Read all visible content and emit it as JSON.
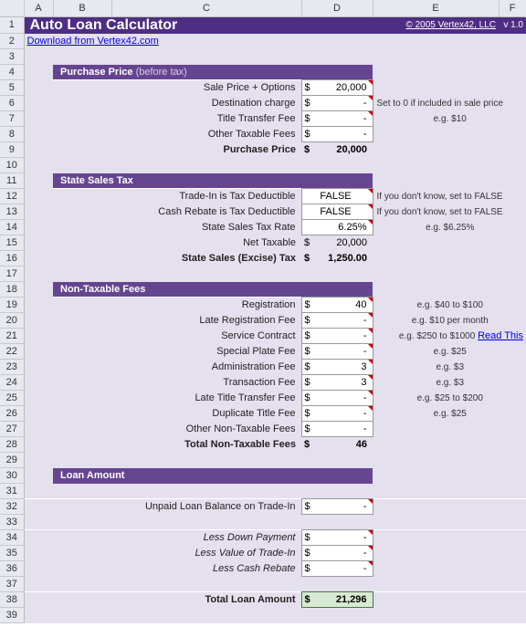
{
  "cols": [
    "",
    "A",
    "B",
    "C",
    "D",
    "E",
    "F"
  ],
  "title": "Auto Loan Calculator",
  "copyright": "© 2005 Vertex42, LLC",
  "version": "v 1.0",
  "download_link": "Download from Vertex42.com",
  "sections": {
    "purchase": {
      "title": "Purchase Price",
      "sub": "(before tax)"
    },
    "tax": {
      "title": "State Sales Tax"
    },
    "fees": {
      "title": "Non-Taxable Fees"
    },
    "loan": {
      "title": "Loan Amount"
    }
  },
  "rows": {
    "r5": {
      "label": "Sale Price + Options",
      "cur": "$",
      "val": "20,000",
      "note": ""
    },
    "r6": {
      "label": "Destination charge",
      "cur": "$",
      "val": "-",
      "note": "Set to 0 if included in sale price"
    },
    "r7": {
      "label": "Title Transfer Fee",
      "cur": "$",
      "val": "-",
      "note": "e.g. $10"
    },
    "r8": {
      "label": "Other Taxable Fees",
      "cur": "$",
      "val": "-",
      "note": ""
    },
    "r9": {
      "label": "Purchase Price",
      "cur": "$",
      "val": "20,000"
    },
    "r12": {
      "label": "Trade-In is Tax Deductible",
      "val": "FALSE",
      "note": "If you don't know, set to FALSE"
    },
    "r13": {
      "label": "Cash Rebate is Tax Deductible",
      "val": "FALSE",
      "note": "If you don't know, set to FALSE"
    },
    "r14": {
      "label": "State Sales Tax Rate",
      "val": "6.25%",
      "note": "e.g. $6.25%"
    },
    "r15": {
      "label": "Net Taxable",
      "cur": "$",
      "val": "20,000"
    },
    "r16": {
      "label": "State Sales (Excise) Tax",
      "cur": "$",
      "val": "1,250.00"
    },
    "r19": {
      "label": "Registration",
      "cur": "$",
      "val": "40",
      "note": "e.g. $40 to $100"
    },
    "r20": {
      "label": "Late Registration Fee",
      "cur": "$",
      "val": "-",
      "note": "e.g. $10 per month"
    },
    "r21": {
      "label": "Service Contract",
      "cur": "$",
      "val": "-",
      "note": "e.g. $250 to $1000",
      "link": "Read This"
    },
    "r22": {
      "label": "Special Plate Fee",
      "cur": "$",
      "val": "-",
      "note": "e.g. $25"
    },
    "r23": {
      "label": "Administration Fee",
      "cur": "$",
      "val": "3",
      "note": "e.g. $3"
    },
    "r24": {
      "label": "Transaction Fee",
      "cur": "$",
      "val": "3",
      "note": "e.g. $3"
    },
    "r25": {
      "label": "Late Title Transfer Fee",
      "cur": "$",
      "val": "-",
      "note": "e.g. $25 to $200"
    },
    "r26": {
      "label": "Duplicate Title Fee",
      "cur": "$",
      "val": "-",
      "note": "e.g. $25"
    },
    "r27": {
      "label": "Other Non-Taxable Fees",
      "cur": "$",
      "val": "-",
      "note": ""
    },
    "r28": {
      "label": "Total Non-Taxable Fees",
      "cur": "$",
      "val": "46"
    },
    "r32": {
      "label": "Unpaid Loan Balance on Trade-In",
      "cur": "$",
      "val": "-"
    },
    "r34": {
      "label": "Less Down Payment",
      "cur": "$",
      "val": "-"
    },
    "r35": {
      "label": "Less Value of Trade-In",
      "cur": "$",
      "val": "-"
    },
    "r36": {
      "label": "Less Cash Rebate",
      "cur": "$",
      "val": "-"
    },
    "r38": {
      "label": "Total Loan Amount",
      "cur": "$",
      "val": "21,296"
    }
  }
}
